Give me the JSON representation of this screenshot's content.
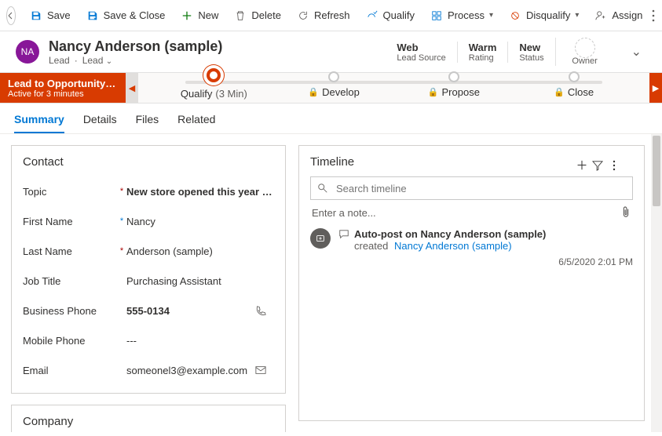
{
  "commandBar": {
    "save": "Save",
    "saveClose": "Save & Close",
    "new": "New",
    "delete": "Delete",
    "refresh": "Refresh",
    "qualify": "Qualify",
    "process": "Process",
    "disqualify": "Disqualify",
    "assign": "Assign"
  },
  "header": {
    "initials": "NA",
    "title": "Nancy Anderson (sample)",
    "entity": "Lead",
    "form": "Lead",
    "stats": [
      {
        "value": "Web",
        "label": "Lead Source"
      },
      {
        "value": "Warm",
        "label": "Rating"
      },
      {
        "value": "New",
        "label": "Status"
      }
    ],
    "ownerLabel": "Owner"
  },
  "bpf": {
    "processName": "Lead to Opportunity Sale...",
    "activeText": "Active for 3 minutes",
    "stages": [
      {
        "label": "Qualify",
        "detail": "(3 Min)",
        "active": true,
        "locked": false
      },
      {
        "label": "Develop",
        "detail": "",
        "active": false,
        "locked": true
      },
      {
        "label": "Propose",
        "detail": "",
        "active": false,
        "locked": true
      },
      {
        "label": "Close",
        "detail": "",
        "active": false,
        "locked": true
      }
    ]
  },
  "tabs": [
    "Summary",
    "Details",
    "Files",
    "Related"
  ],
  "activeTab": "Summary",
  "contact": {
    "heading": "Contact",
    "fields": {
      "topic": {
        "label": "Topic",
        "value": "New store opened this year - f...",
        "required": "*"
      },
      "firstName": {
        "label": "First Name",
        "value": "Nancy",
        "required": "*"
      },
      "lastName": {
        "label": "Last Name",
        "value": "Anderson (sample)",
        "required": "*"
      },
      "jobTitle": {
        "label": "Job Title",
        "value": "Purchasing Assistant"
      },
      "businessPhone": {
        "label": "Business Phone",
        "value": "555-0134"
      },
      "mobilePhone": {
        "label": "Mobile Phone",
        "value": "---"
      },
      "email": {
        "label": "Email",
        "value": "someonel3@example.com"
      }
    }
  },
  "company": {
    "heading": "Company"
  },
  "timeline": {
    "heading": "Timeline",
    "searchPlaceholder": "Search timeline",
    "notePlaceholder": "Enter a note...",
    "post": {
      "title": "Auto-post on Nancy Anderson (sample)",
      "createdLabel": "created",
      "who": "Nancy Anderson (sample)",
      "time": "6/5/2020 2:01 PM"
    }
  }
}
